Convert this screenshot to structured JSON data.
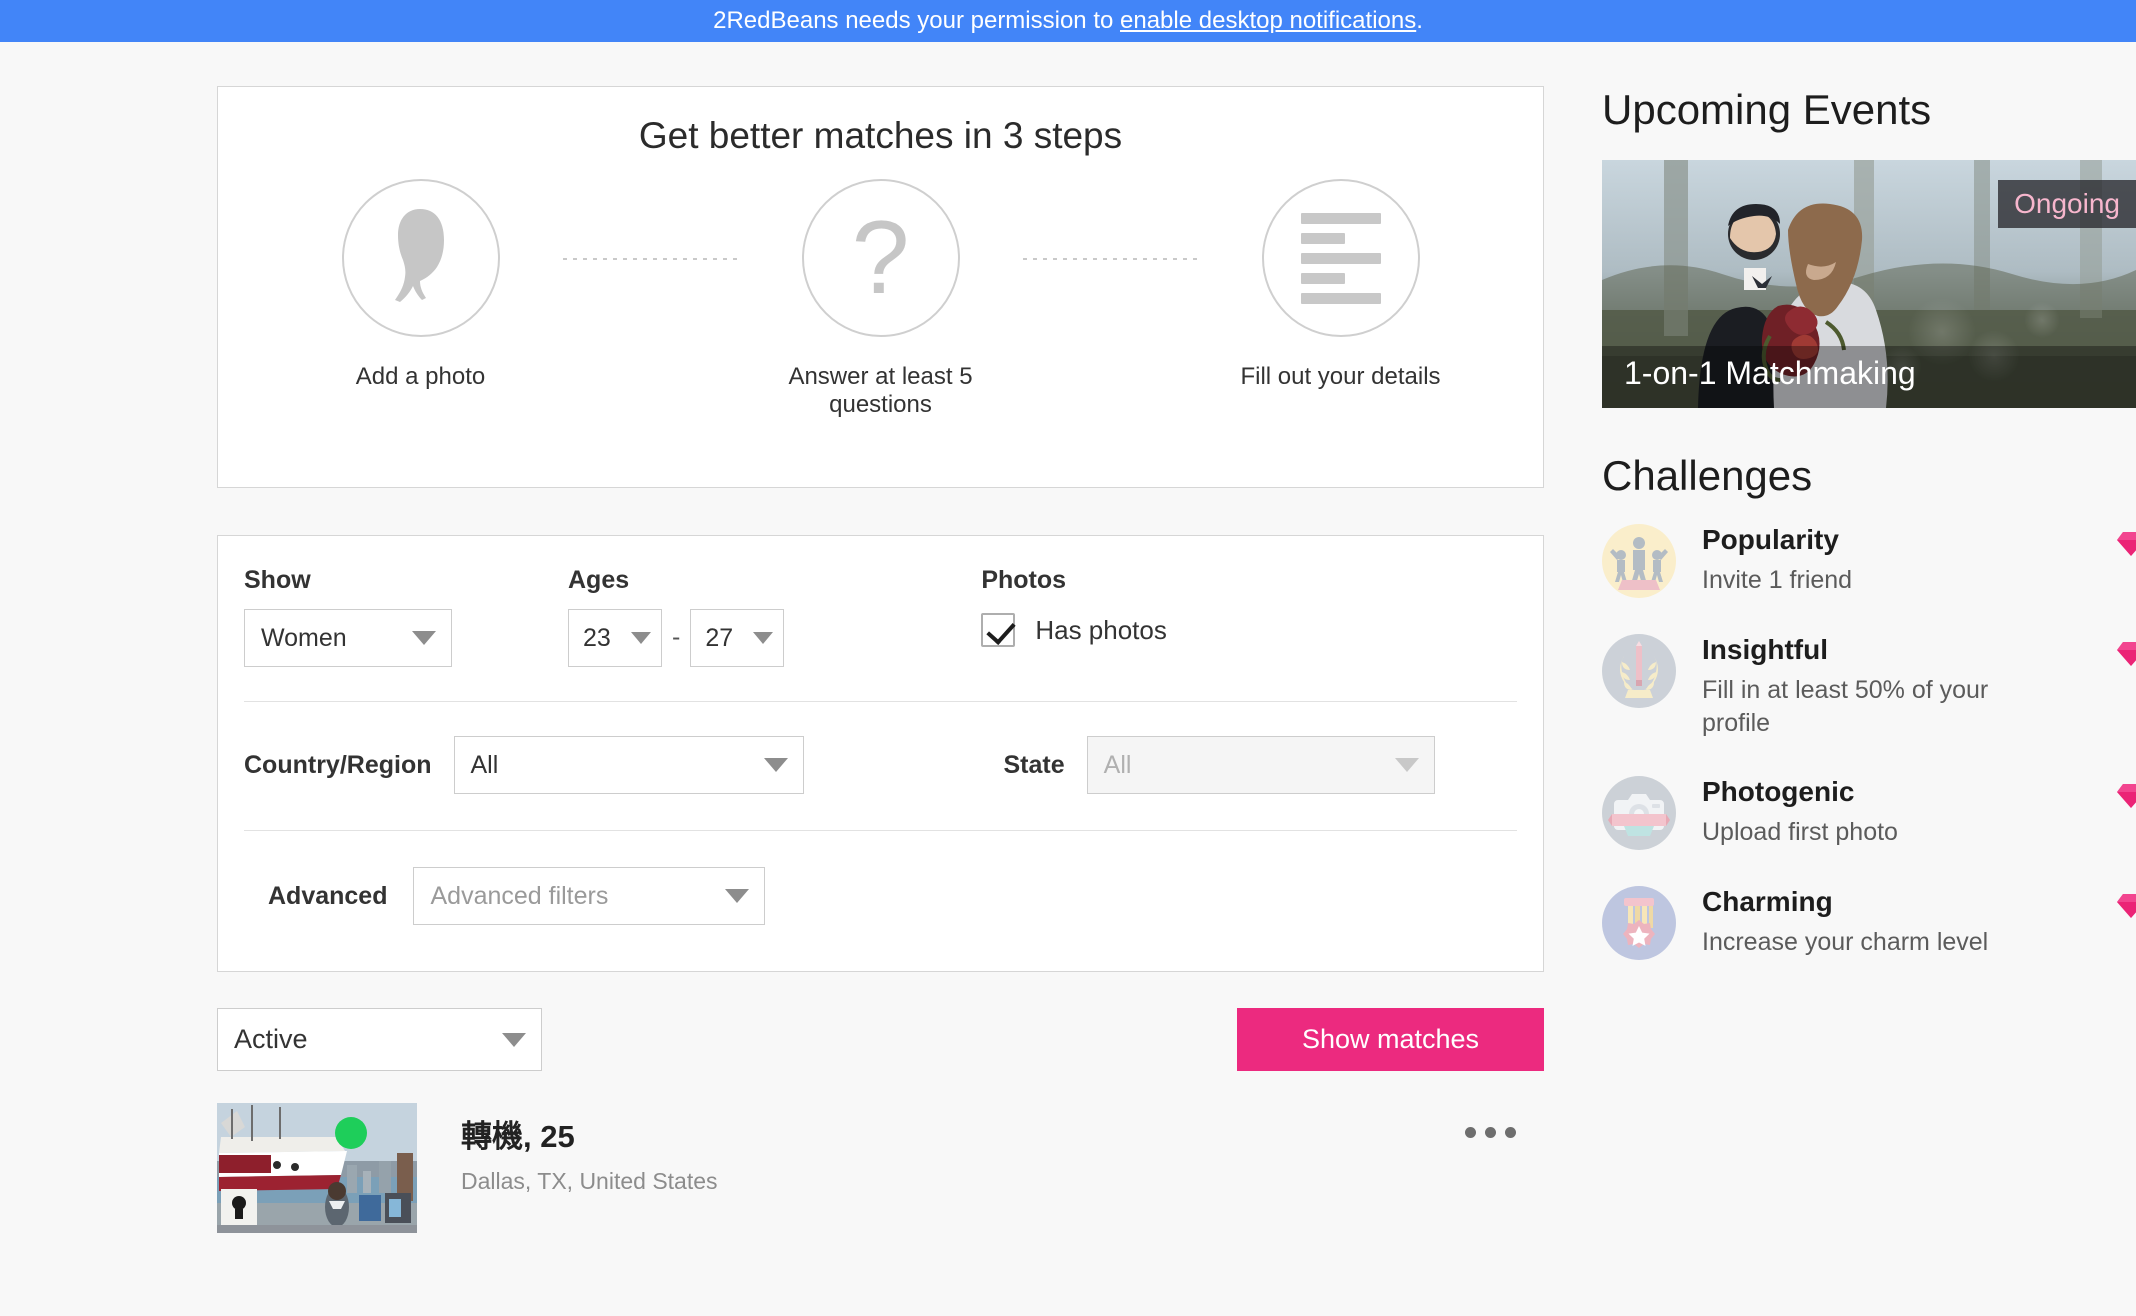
{
  "notification": {
    "prefix": "2RedBeans needs your permission to ",
    "link": "enable desktop notifications",
    "suffix": "."
  },
  "steps_card": {
    "title": "Get better matches in 3 steps",
    "steps": [
      {
        "icon": "person-silhouette-icon",
        "label": "Add a photo"
      },
      {
        "icon": "question-mark-icon",
        "label": "Answer at least 5 questions"
      },
      {
        "icon": "text-lines-icon",
        "label": "Fill out your details"
      }
    ]
  },
  "filters": {
    "show": {
      "label": "Show",
      "value": "Women"
    },
    "ages": {
      "label": "Ages",
      "min": "23",
      "dash": "-",
      "max": "27"
    },
    "photos": {
      "label": "Photos",
      "checkbox_label": "Has photos",
      "checked": true
    },
    "country": {
      "label": "Country/Region",
      "value": "All"
    },
    "state": {
      "label": "State",
      "value": "All",
      "disabled": true
    },
    "advanced": {
      "label": "Advanced",
      "placeholder": "Advanced filters"
    }
  },
  "actions": {
    "sort": "Active",
    "show_matches": "Show matches"
  },
  "results": [
    {
      "name": "轉機, 25",
      "location": "Dallas, TX, United States",
      "online": true,
      "menu_icon": "kebab-menu-icon"
    }
  ],
  "sidebar": {
    "events_title": "Upcoming Events",
    "event": {
      "name": "1-on-1 Matchmaking",
      "badge": "Ongoing"
    },
    "challenges_title": "Challenges",
    "challenges": [
      {
        "name": "Popularity",
        "desc": "Invite 1 friend",
        "icon": "podium-icon",
        "bg": "#faeecb",
        "gem": "gem-icon"
      },
      {
        "name": "Insightful",
        "desc": "Fill in at least 50% of your profile",
        "icon": "laurel-pencil-icon",
        "bg": "#cdd2d8",
        "gem": "gem-icon"
      },
      {
        "name": "Photogenic",
        "desc": "Upload first photo",
        "icon": "camera-icon",
        "bg": "#ccd1d7",
        "gem": "gem-icon"
      },
      {
        "name": "Charming",
        "desc": "Increase your charm level",
        "icon": "medal-icon",
        "bg": "#bec6e0",
        "gem": "gem-icon"
      }
    ]
  },
  "colors": {
    "notif_bg": "#4285f8",
    "accent_pink": "#ec2a7f",
    "online_green": "#1ece5a",
    "page_bg": "#f8f8f8"
  }
}
